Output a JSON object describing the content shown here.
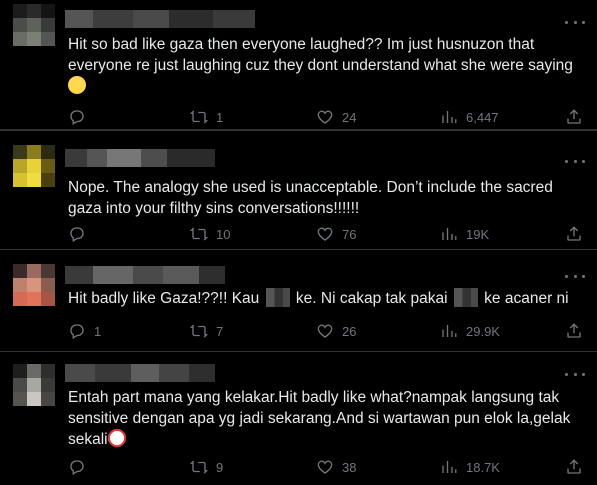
{
  "replies": [
    {
      "text_lines": [
        "Hit so bad like gaza then everyone laughed?? Im just husnuzon that",
        "everyone re just laughing cuz they dont understand what she were saying"
      ],
      "emoji": "😵‍💫",
      "reply_count": "",
      "repost_count": "1",
      "like_count": "24",
      "view_count": "6,447"
    },
    {
      "text_lines": [
        "Nope. The analogy she used is unacceptable. Don’t include the sacred",
        "gaza into your filthy sins conversations!!!!!!"
      ],
      "reply_count": "",
      "repost_count": "10",
      "like_count": "76",
      "view_count": "19K"
    },
    {
      "text_parts": [
        "Hit badly like Gaza!??!! Kau",
        "ke. Ni cakap tak pakai",
        "ke acaner ni"
      ],
      "reply_count": "1",
      "repost_count": "7",
      "like_count": "26",
      "view_count": "29.9K"
    },
    {
      "text_lines": [
        "Entah part mana yang kelakar.Hit badly like what?nampak langsung tak",
        "sensitive dengan apa yg jadi sekarang.And si wartawan pun elok la,gelak",
        "sekali"
      ],
      "emoji": "🤡",
      "reply_count": "",
      "repost_count": "9",
      "like_count": "38",
      "view_count": "18.7K"
    }
  ],
  "colors": {
    "background": "#000000",
    "text": "#e7e9ea",
    "muted": "#71767b",
    "divider": "#2f3336"
  },
  "icons": [
    "reply-icon",
    "repost-icon",
    "like-icon",
    "views-icon",
    "share-icon",
    "more-icon"
  ]
}
